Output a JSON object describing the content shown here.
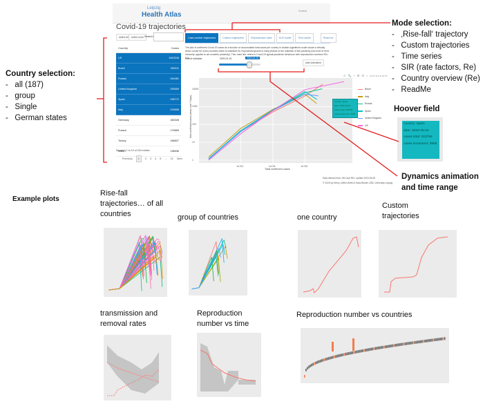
{
  "app": {
    "logo_small": "Leipzig",
    "logo_main": "Health Atlas",
    "topbar_right": "Zurück",
    "title": "Covid-19 trajectories",
    "select_all": "select all",
    "select_none": "select none",
    "search_label": "Search:",
    "search_value": "",
    "table": {
      "headers": [
        "Country",
        "Cases"
      ],
      "rows": [
        {
          "country": "US",
          "cases": "1643246",
          "selected": true
        },
        {
          "country": "Brazil",
          "cases": "363211",
          "selected": true
        },
        {
          "country": "Russia",
          "cases": "344481",
          "selected": true
        },
        {
          "country": "United Kingdom",
          "cases": "259559",
          "selected": true
        },
        {
          "country": "Spain",
          "cases": "235772",
          "selected": true
        },
        {
          "country": "Italy",
          "cases": "229858",
          "selected": true
        },
        {
          "country": "Germany",
          "cases": "180328",
          "selected": false
        },
        {
          "country": "France",
          "cases": "179859",
          "selected": false
        },
        {
          "country": "Turkey",
          "cases": "156827",
          "selected": false
        },
        {
          "country": "India",
          "cases": "138536",
          "selected": false
        }
      ],
      "info": "Showing 1 to 10 of 204 entries",
      "pager": [
        "Previous",
        "1",
        "2",
        "3",
        "4",
        "5",
        "...",
        "21",
        "Next"
      ]
    },
    "tabs": [
      {
        "label": "Case number trajectories",
        "active": true
      },
      {
        "label": "Custom trajectories",
        "active": false
      },
      {
        "label": "Reproduction rates",
        "active": false
      },
      {
        "label": "SI-R model",
        "active": false
      },
      {
        "label": "Time series",
        "active": false
      },
      {
        "label": "Read me",
        "active": false
      }
    ],
    "description": "The plot of confirmed Covid-19 cases as a function of accumulated total cases per country in double-logarithmic scale shows a virtually linear course for most countries which is indicative for exponential growth in early phases of the outbreak of the pandemy (low level of herd immunity; applies to all countries presently). This 'main line' refers to Covid-19 typical pandemic behaviour with reproduction numbers R0= 2-3.",
    "subdata_label": "Select subdata:",
    "date_start": "2020-01-20",
    "date_end": "2020-04-20",
    "slider_fraction": 0.7,
    "animation_button": "start animation",
    "modebar": "⊙ 🔍 + ⊞ ⊟ ⌂ autoscale",
    "credits_line1": "Data derived from JHU and RKI, update 2020-05-05",
    "credits_line2": "© 2020 by Henry Löffler-Wirth & Hans Binder, IZBI, University Leipzig"
  },
  "chart_data": {
    "type": "line",
    "title": "",
    "xlabel": "Total confirmed cases",
    "ylabel": "New confirmed cases (mean over 7 days)",
    "x_scale": "log",
    "y_scale": "log",
    "x_ticks": [
      "1e+03",
      "1e+04",
      "1e+05"
    ],
    "y_ticks": [
      "1",
      "10",
      "100",
      "1000",
      "10000"
    ],
    "grid": true,
    "legend_position": "right",
    "series": [
      {
        "name": "Brazil",
        "color": "#f8766d",
        "x": [
          100,
          1000,
          10000,
          100000,
          360000
        ],
        "y": [
          1.2,
          40,
          500,
          4000,
          18000
        ]
      },
      {
        "name": "Italy",
        "color": "#c49a00",
        "x": [
          100,
          1000,
          10000,
          100000,
          230000
        ],
        "y": [
          1.5,
          60,
          700,
          5000,
          1500
        ]
      },
      {
        "name": "Russia",
        "color": "#00c08b",
        "x": [
          100,
          1000,
          10000,
          100000,
          344000
        ],
        "y": [
          1.2,
          40,
          600,
          6000,
          10000
        ]
      },
      {
        "name": "Spain",
        "color": "#00c0d0",
        "x": [
          100,
          1000,
          10000,
          100000,
          235000
        ],
        "y": [
          1.2,
          45,
          650,
          7000,
          2500
        ]
      },
      {
        "name": "United Kingdom",
        "color": "#619cff",
        "x": [
          100,
          1000,
          10000,
          100000,
          260000
        ],
        "y": [
          1.1,
          40,
          600,
          5000,
          4000
        ]
      },
      {
        "name": "US",
        "color": "#f564e3",
        "x": [
          100,
          1000,
          10000,
          100000,
          1640000
        ],
        "y": [
          1,
          30,
          600,
          9000,
          25000
        ]
      }
    ],
    "tooltip": {
      "country": "Spain",
      "date": "2020-04-25",
      "cases_total": "223759",
      "cases_increment": "3995"
    }
  },
  "annotations": {
    "country_selection": {
      "title": "Country selection:",
      "items": [
        "all (187)",
        "group",
        "Single",
        "German states"
      ]
    },
    "mode_selection": {
      "title": "Mode selection:",
      "items": [
        "‚Rise-fall‘ trajectory",
        "Custom trajectories",
        "Time series",
        "SIR (rate factors, Re)",
        "Country overview (Re)",
        "ReadMe"
      ]
    },
    "hoover": {
      "title": "Hoover field",
      "lines": [
        "country: Spain",
        "date: 2020-25-04",
        "cases total: 223759",
        "cases increment: 3995"
      ]
    },
    "dynamics": {
      "line1": "Dynamics animation",
      "line2": "and time range"
    },
    "example_title": "Example plots",
    "examples": [
      {
        "caption": "Rise-fall trajectories… of all countries"
      },
      {
        "caption": "group of countries"
      },
      {
        "caption": "one country"
      },
      {
        "caption": "Custom trajectories"
      },
      {
        "caption": "transmission and removal rates"
      },
      {
        "caption": "Reproduction number vs time"
      },
      {
        "caption": "Reproduction number vs countries"
      }
    ]
  }
}
